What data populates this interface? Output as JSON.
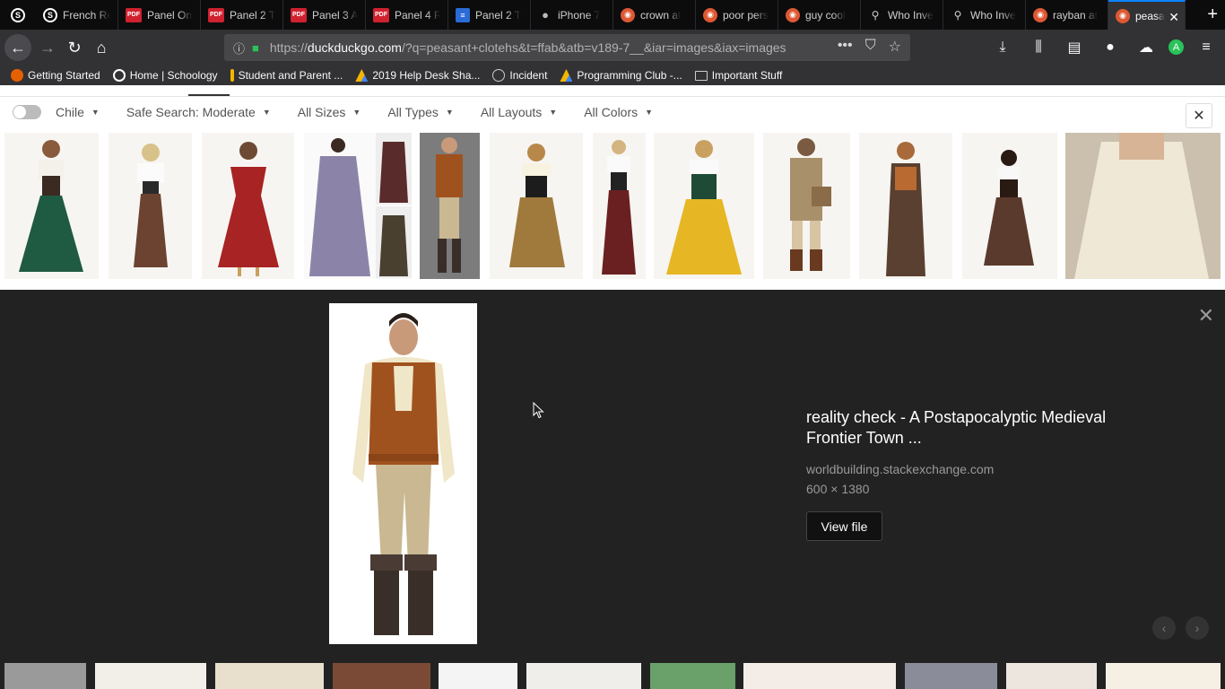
{
  "browser": {
    "tabs": [
      {
        "title": "French Re",
        "icon": "schoology-icon"
      },
      {
        "title": "Panel One",
        "icon": "pdf-icon"
      },
      {
        "title": "Panel 2 T",
        "icon": "pdf-icon"
      },
      {
        "title": "Panel 3 A",
        "icon": "pdf-icon"
      },
      {
        "title": "Panel 4 R",
        "icon": "pdf-icon"
      },
      {
        "title": "Panel 2 T",
        "icon": "docs-icon"
      },
      {
        "title": "iPhone 7",
        "icon": "apple-icon"
      },
      {
        "title": "crown at",
        "icon": "duckduckgo-icon"
      },
      {
        "title": "poor pers",
        "icon": "duckduckgo-icon"
      },
      {
        "title": "guy cool",
        "icon": "duckduckgo-icon"
      },
      {
        "title": "Who Inve",
        "icon": "search-icon"
      },
      {
        "title": "Who Inve",
        "icon": "search-icon"
      },
      {
        "title": "rayban at",
        "icon": "duckduckgo-icon"
      }
    ],
    "active_tab": {
      "title": "peasa",
      "icon": "duckduckgo-icon"
    },
    "url_prefix": "https://",
    "url_domain": "duckduckgo.com",
    "url_rest": "/?q=peasant+clotehs&t=ffab&atb=v189-7__&iar=images&iax=images",
    "bookmarks": [
      {
        "label": "Getting Started",
        "icon": "firefox-icon"
      },
      {
        "label": "Home | Schoology",
        "icon": "schoology-icon"
      },
      {
        "label": "Student and Parent ...",
        "icon": "powerschool-icon"
      },
      {
        "label": "2019 Help Desk Sha...",
        "icon": "drive-icon"
      },
      {
        "label": "Incident",
        "icon": "globe-icon"
      },
      {
        "label": "Programming Club -...",
        "icon": "drive-icon"
      },
      {
        "label": "Important Stuff",
        "icon": "folder-icon"
      }
    ]
  },
  "filters": {
    "region": "Chile",
    "safe_search": "Safe Search: Moderate",
    "sizes": "All Sizes",
    "types": "All Types",
    "layouts": "All Layouts",
    "colors": "All Colors"
  },
  "detail": {
    "title": "reality check - A Postapocalyptic Medieval Frontier Town ...",
    "source": "worldbuilding.stackexchange.com",
    "dimensions": "600 × 1380",
    "view_file_label": "View file"
  },
  "colors": {
    "accent": "#0a84ff",
    "panel_bg": "#222222",
    "toolbar_bg": "#323234"
  }
}
